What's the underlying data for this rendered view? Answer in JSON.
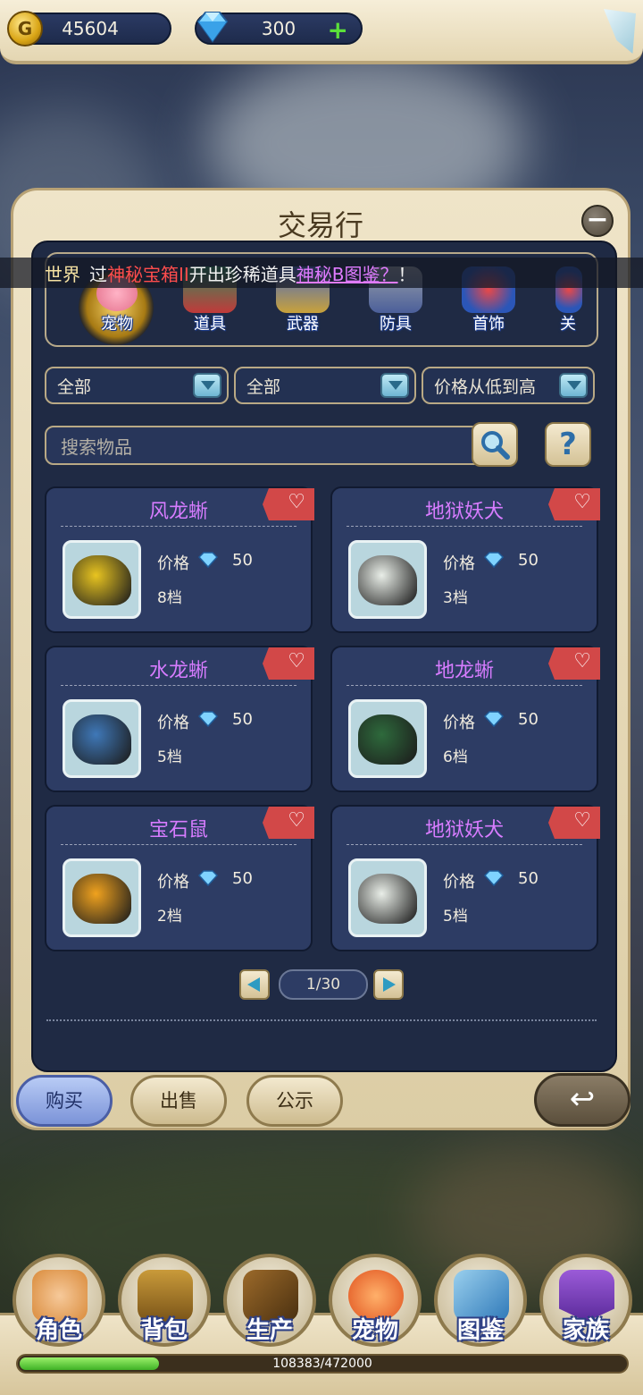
{
  "currency": {
    "gold": "45604",
    "gems": "300",
    "gem_add": "+"
  },
  "panel": {
    "title": "交易行",
    "close": "−"
  },
  "broadcast": {
    "channel": "世界",
    "seg1": "过",
    "seg2": "神秘宝箱II",
    "seg3": "开出珍稀道具",
    "seg4": "神秘B图鉴？",
    "seg5": "！"
  },
  "categories": [
    {
      "label": "宠物",
      "selected": true,
      "icon": "pet-category-icon"
    },
    {
      "label": "道具",
      "selected": false,
      "icon": "item-category-icon"
    },
    {
      "label": "武器",
      "selected": false,
      "icon": "weapon-category-icon"
    },
    {
      "label": "防具",
      "selected": false,
      "icon": "armor-category-icon"
    },
    {
      "label": "首饰",
      "selected": false,
      "icon": "jewelry-category-icon"
    },
    {
      "label": "关",
      "selected": false,
      "icon": "more-category-icon"
    }
  ],
  "filters": {
    "filter1": "全部",
    "filter2": "全部",
    "sort": "价格从低到高"
  },
  "search": {
    "placeholder": "搜索物品",
    "help": "?"
  },
  "price_label": "价格",
  "items": [
    {
      "name": "风龙蜥",
      "price": "50",
      "tier": "8档",
      "color": "#e8c420"
    },
    {
      "name": "地狱妖犬",
      "price": "50",
      "tier": "3档",
      "color": "#e9eee8"
    },
    {
      "name": "水龙蜥",
      "price": "50",
      "tier": "5档",
      "color": "#3f78b8"
    },
    {
      "name": "地龙蜥",
      "price": "50",
      "tier": "6档",
      "color": "#2e6a3c"
    },
    {
      "name": "宝石鼠",
      "price": "50",
      "tier": "2档",
      "color": "#f0a21e"
    },
    {
      "name": "地狱妖犬",
      "price": "50",
      "tier": "5档",
      "color": "#e9eee8"
    }
  ],
  "pager": {
    "text": "1/30"
  },
  "tabs": {
    "buy": "购买",
    "sell": "出售",
    "public": "公示",
    "back": "↩"
  },
  "nav": [
    {
      "label": "角色",
      "icon": "character-icon"
    },
    {
      "label": "背包",
      "icon": "backpack-icon"
    },
    {
      "label": "生产",
      "icon": "production-icon"
    },
    {
      "label": "宠物",
      "icon": "pet-icon"
    },
    {
      "label": "图鉴",
      "icon": "handbook-icon"
    },
    {
      "label": "家族",
      "icon": "family-icon"
    }
  ],
  "xp": {
    "current": 108383,
    "max": 472000,
    "text": "108383/472000"
  },
  "colors": {
    "accent_pink": "#d77cff",
    "fav_red": "#d24848",
    "panel_dark": "#1f2a44"
  }
}
